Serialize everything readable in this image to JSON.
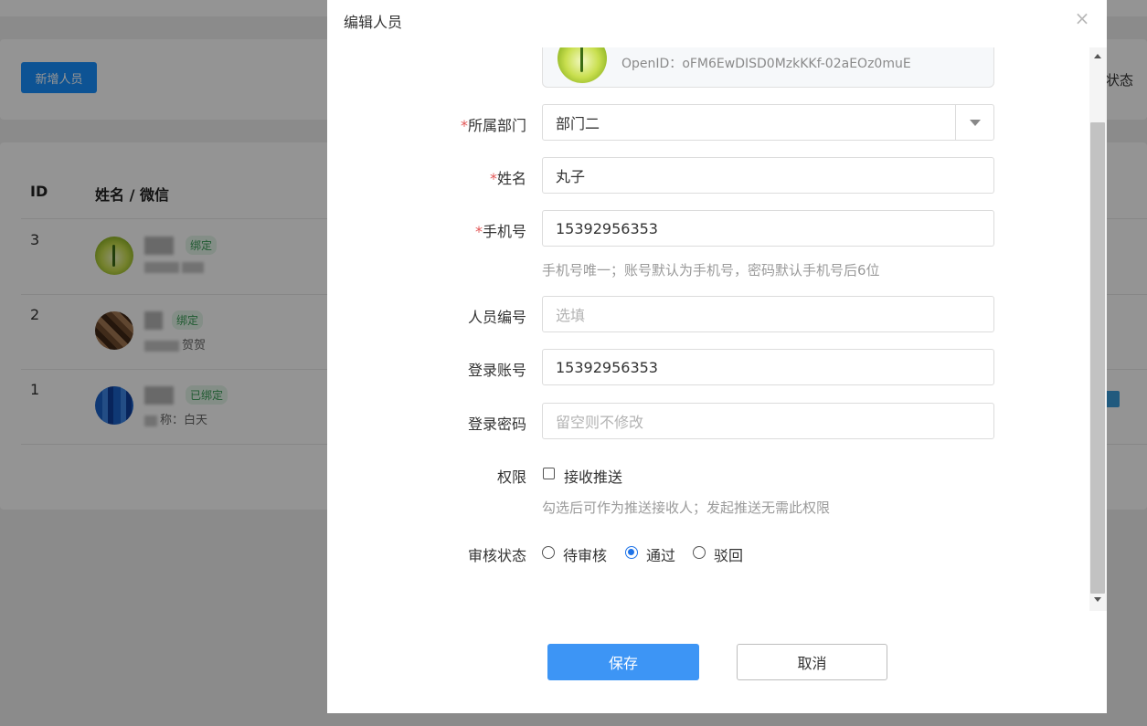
{
  "background": {
    "add_button": "新增人员",
    "status_header": "状态",
    "table": {
      "headers": [
        "ID",
        "姓名 / 微信"
      ],
      "rows": [
        {
          "id": "3",
          "badge": "绑定",
          "sub": ""
        },
        {
          "id": "2",
          "badge": "绑定",
          "sub": "贺贺"
        },
        {
          "id": "1",
          "badge": "已绑定",
          "sub": "称：白天"
        }
      ]
    }
  },
  "modal": {
    "title": "编辑人员",
    "close_icon": "close-icon",
    "wechat": {
      "openid_label": "OpenID：",
      "openid_value": "oFM6EwDISD0MzkKKf-02aEOz0muE"
    },
    "fields": {
      "department": {
        "required": "*",
        "label": "所属部门",
        "value": "部门二"
      },
      "name": {
        "required": "*",
        "label": "姓名",
        "value": "丸子"
      },
      "phone": {
        "required": "*",
        "label": "手机号",
        "value": "15392956353",
        "hint": "手机号唯一；账号默认为手机号，密码默认手机号后6位"
      },
      "employee_no": {
        "label": "人员编号",
        "placeholder": "选填"
      },
      "account": {
        "label": "登录账号",
        "value": "15392956353"
      },
      "password": {
        "label": "登录密码",
        "placeholder": "留空则不修改"
      },
      "permission": {
        "label": "权限",
        "option": "接收推送",
        "checked": false,
        "hint": "勾选后可作为推送接收人；发起推送无需此权限"
      },
      "review": {
        "label": "审核状态",
        "options": [
          "待审核",
          "通过",
          "驳回"
        ],
        "selected": "通过"
      }
    },
    "buttons": {
      "save": "保存",
      "cancel": "取消"
    }
  },
  "colors": {
    "primary": "#3d95f5",
    "required": "#e25555",
    "badge_green": "#3a9e57"
  }
}
